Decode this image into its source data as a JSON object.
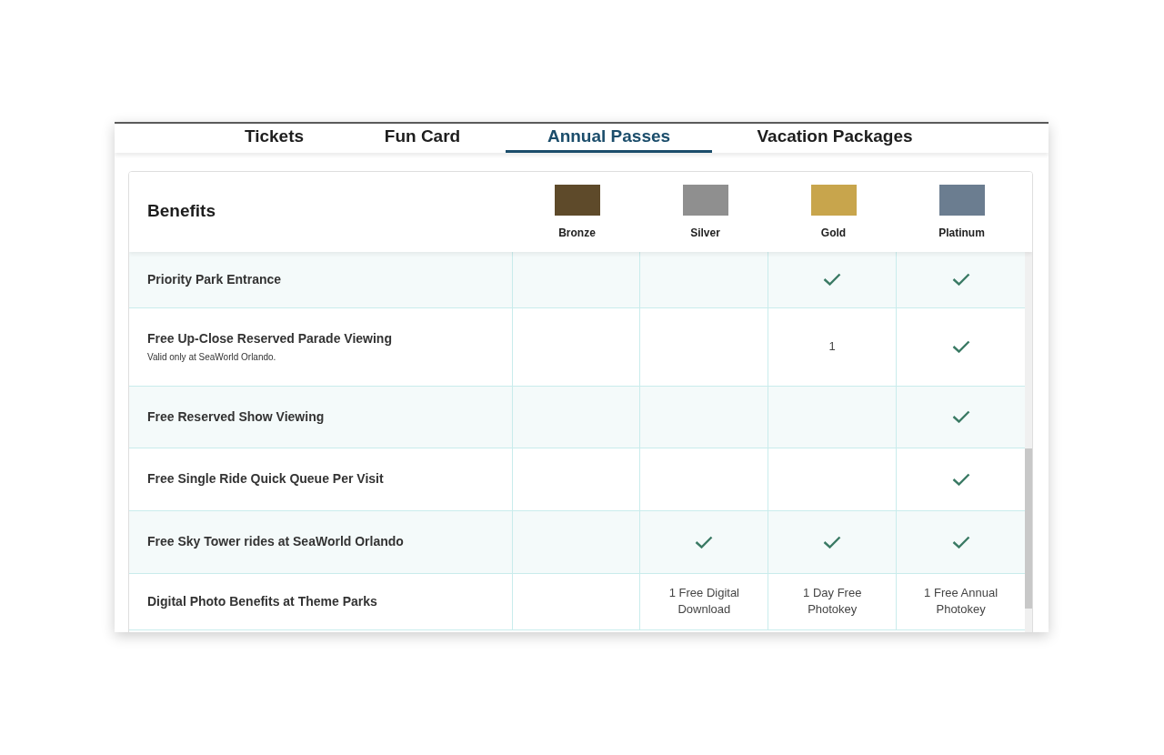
{
  "tabs": [
    {
      "label": "Tickets",
      "selected": false
    },
    {
      "label": "Fun Card",
      "selected": false
    },
    {
      "label": "Annual Passes",
      "selected": true
    },
    {
      "label": "Vacation Packages",
      "selected": false
    }
  ],
  "table": {
    "heading": "Benefits",
    "tiers": [
      {
        "name": "Bronze",
        "color": "#5e4a2a"
      },
      {
        "name": "Silver",
        "color": "#8f8f8f"
      },
      {
        "name": "Gold",
        "color": "#c8a54c"
      },
      {
        "name": "Platinum",
        "color": "#6b7d90"
      }
    ],
    "rows": [
      {
        "label": "Priority Park Entrance",
        "cells": [
          {
            "kind": "empty"
          },
          {
            "kind": "empty"
          },
          {
            "kind": "check"
          },
          {
            "kind": "check"
          }
        ]
      },
      {
        "label": "Free Up-Close Reserved Parade Viewing",
        "note": "Valid only at SeaWorld Orlando.",
        "cells": [
          {
            "kind": "empty"
          },
          {
            "kind": "empty"
          },
          {
            "kind": "text",
            "text": "1"
          },
          {
            "kind": "check"
          }
        ]
      },
      {
        "label": "Free Reserved Show Viewing",
        "cells": [
          {
            "kind": "empty"
          },
          {
            "kind": "empty"
          },
          {
            "kind": "empty"
          },
          {
            "kind": "check"
          }
        ]
      },
      {
        "label": "Free Single Ride Quick Queue Per Visit",
        "cells": [
          {
            "kind": "empty"
          },
          {
            "kind": "empty"
          },
          {
            "kind": "empty"
          },
          {
            "kind": "check"
          }
        ]
      },
      {
        "label": "Free Sky Tower rides at SeaWorld Orlando",
        "cells": [
          {
            "kind": "empty"
          },
          {
            "kind": "check"
          },
          {
            "kind": "check"
          },
          {
            "kind": "check"
          }
        ]
      },
      {
        "label": "Digital Photo Benefits at Theme Parks",
        "cells": [
          {
            "kind": "empty"
          },
          {
            "kind": "text",
            "text": "1 Free Digital Download"
          },
          {
            "kind": "text",
            "text": "1 Day Free Photokey"
          },
          {
            "kind": "text",
            "text": "1 Free Annual Photokey"
          }
        ]
      }
    ]
  }
}
